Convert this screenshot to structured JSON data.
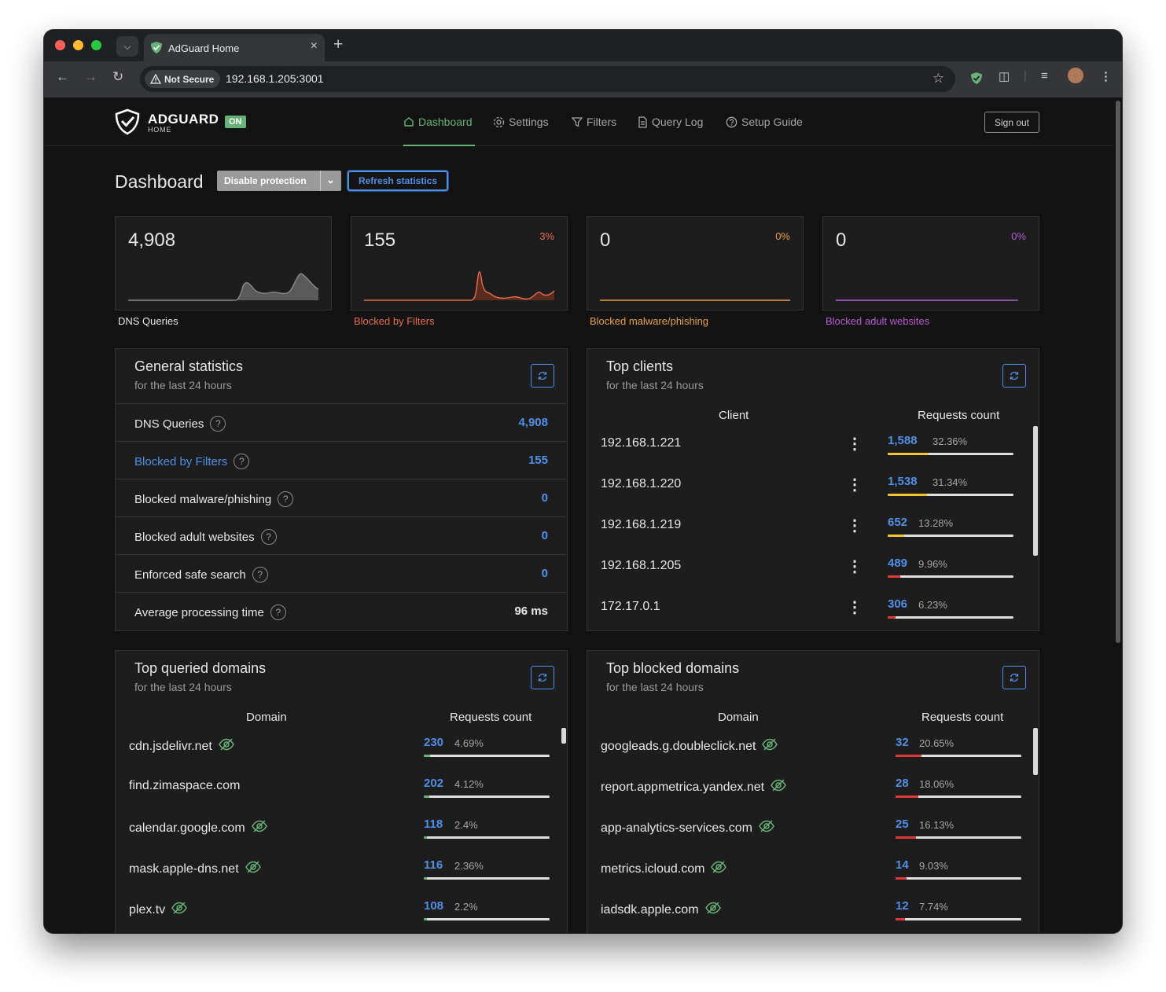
{
  "browser": {
    "tab_title": "AdGuard Home",
    "not_secure": "Not Secure",
    "url": "192.168.1.205:3001"
  },
  "header": {
    "brand": "ADGUARD",
    "brand_sub": "HOME",
    "status_badge": "ON",
    "nav": [
      "Dashboard",
      "Settings",
      "Filters",
      "Query Log",
      "Setup Guide"
    ],
    "active_nav": "Dashboard",
    "sign_out": "Sign out"
  },
  "dashboard": {
    "title": "Dashboard",
    "disable_protection": "Disable protection",
    "refresh_statistics": "Refresh statistics"
  },
  "stat_cards": [
    {
      "value": "4,908",
      "percent": "",
      "label": "DNS Queries",
      "color": "#e6e6e6",
      "line_color": "#8a8a8a"
    },
    {
      "value": "155",
      "percent": "3%",
      "label": "Blocked by Filters",
      "color": "#eb6b4b",
      "line_color": "#eb6b4b"
    },
    {
      "value": "0",
      "percent": "0%",
      "label": "Blocked malware/phishing",
      "color": "#e8a13a",
      "line_color": "#e8a13a"
    },
    {
      "value": "0",
      "percent": "0%",
      "label": "Blocked adult websites",
      "color": "#b35bd0",
      "line_color": "#b35bd0"
    }
  ],
  "general_statistics": {
    "title": "General statistics",
    "subtitle": "for the last 24 hours",
    "rows": [
      {
        "label": "DNS Queries",
        "value": "4,908",
        "label_color": "#e6e6e6",
        "value_color": "#4f8fe6"
      },
      {
        "label": "Blocked by Filters",
        "value": "155",
        "label_color": "#4f8fe6",
        "value_color": "#4f8fe6"
      },
      {
        "label": "Blocked malware/phishing",
        "value": "0",
        "label_color": "#e6e6e6",
        "value_color": "#4f8fe6"
      },
      {
        "label": "Blocked adult websites",
        "value": "0",
        "label_color": "#e6e6e6",
        "value_color": "#4f8fe6"
      },
      {
        "label": "Enforced safe search",
        "value": "0",
        "label_color": "#e6e6e6",
        "value_color": "#4f8fe6"
      },
      {
        "label": "Average processing time",
        "value": "96 ms",
        "label_color": "#e6e6e6",
        "value_color": "#e6e6e6"
      }
    ]
  },
  "top_clients": {
    "title": "Top clients",
    "subtitle": "for the last 24 hours",
    "col_client": "Client",
    "col_requests": "Requests count",
    "rows": [
      {
        "client": "192.168.1.221",
        "count": "1,588",
        "percent": "32.36%",
        "fraction": 0.3236,
        "color": "#f4c430"
      },
      {
        "client": "192.168.1.220",
        "count": "1,538",
        "percent": "31.34%",
        "fraction": 0.3134,
        "color": "#f4c430"
      },
      {
        "client": "192.168.1.219",
        "count": "652",
        "percent": "13.28%",
        "fraction": 0.1328,
        "color": "#f4c430"
      },
      {
        "client": "192.168.1.205",
        "count": "489",
        "percent": "9.96%",
        "fraction": 0.0996,
        "color": "#e03a3a"
      },
      {
        "client": "172.17.0.1",
        "count": "306",
        "percent": "6.23%",
        "fraction": 0.0623,
        "color": "#e03a3a"
      }
    ]
  },
  "top_queried": {
    "title": "Top queried domains",
    "subtitle": "for the last 24 hours",
    "col_domain": "Domain",
    "col_requests": "Requests count",
    "rows": [
      {
        "domain": "cdn.jsdelivr.net",
        "count": "230",
        "percent": "4.69%",
        "fraction": 0.0469,
        "color": "#67b279",
        "hidden_icon": true
      },
      {
        "domain": "find.zimaspace.com",
        "count": "202",
        "percent": "4.12%",
        "fraction": 0.0412,
        "color": "#67b279",
        "hidden_icon": false
      },
      {
        "domain": "calendar.google.com",
        "count": "118",
        "percent": "2.4%",
        "fraction": 0.024,
        "color": "#67b279",
        "hidden_icon": true
      },
      {
        "domain": "mask.apple-dns.net",
        "count": "116",
        "percent": "2.36%",
        "fraction": 0.0236,
        "color": "#67b279",
        "hidden_icon": true
      },
      {
        "domain": "plex.tv",
        "count": "108",
        "percent": "2.2%",
        "fraction": 0.022,
        "color": "#67b279",
        "hidden_icon": true
      }
    ]
  },
  "top_blocked": {
    "title": "Top blocked domains",
    "subtitle": "for the last 24 hours",
    "col_domain": "Domain",
    "col_requests": "Requests count",
    "rows": [
      {
        "domain": "googleads.g.doubleclick.net",
        "count": "32",
        "percent": "20.65%",
        "fraction": 0.2065,
        "color": "#e03a3a",
        "hidden_icon": true
      },
      {
        "domain": "report.appmetrica.yandex.net",
        "count": "28",
        "percent": "18.06%",
        "fraction": 0.1806,
        "color": "#e03a3a",
        "hidden_icon": true
      },
      {
        "domain": "app-analytics-services.com",
        "count": "25",
        "percent": "16.13%",
        "fraction": 0.1613,
        "color": "#e03a3a",
        "hidden_icon": true
      },
      {
        "domain": "metrics.icloud.com",
        "count": "14",
        "percent": "9.03%",
        "fraction": 0.0903,
        "color": "#e03a3a",
        "hidden_icon": true
      },
      {
        "domain": "iadsdk.apple.com",
        "count": "12",
        "percent": "7.74%",
        "fraction": 0.0774,
        "color": "#e03a3a",
        "hidden_icon": true
      }
    ]
  }
}
